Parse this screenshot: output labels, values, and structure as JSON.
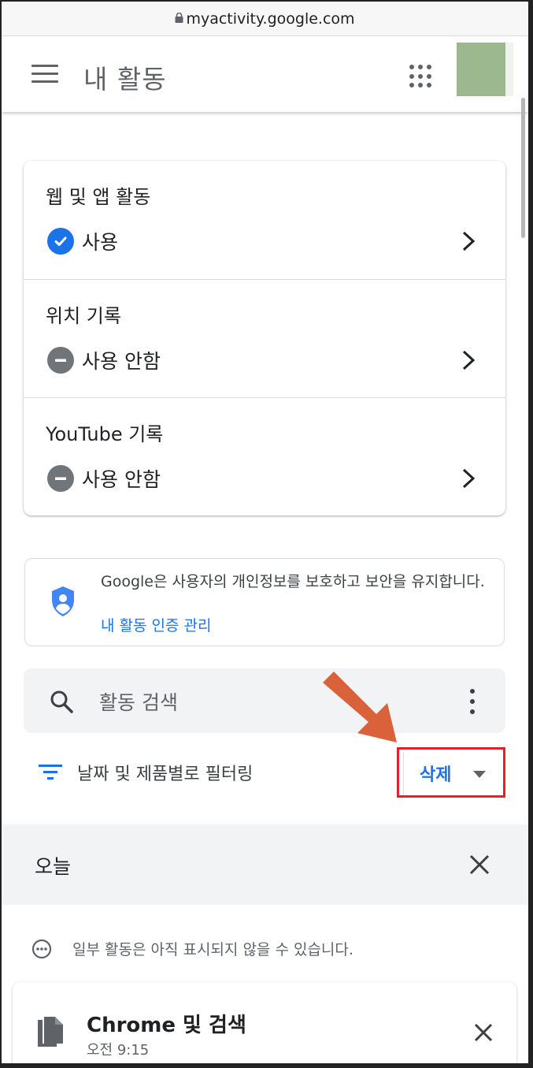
{
  "browser": {
    "url": "myactivity.google.com"
  },
  "header": {
    "title": "내 활동"
  },
  "settings": [
    {
      "name": "웹 및 앱 활동",
      "status": "사용",
      "state": "on"
    },
    {
      "name": "위치 기록",
      "status": "사용 안함",
      "state": "off"
    },
    {
      "name": "YouTube 기록",
      "status": "사용 안함",
      "state": "off"
    }
  ],
  "security": {
    "text": "Google은 사용자의 개인정보를 보호하고 보안을 유지합니다.",
    "link": "내 활동 인증 관리"
  },
  "search": {
    "placeholder": "활동 검색"
  },
  "filter": {
    "label": "날짜 및 제품별로 필터링"
  },
  "delete": {
    "label": "삭제"
  },
  "today": {
    "label": "오늘",
    "notice": "일부 활동은 아직 표시되지 않을 수 있습니다."
  },
  "activity": {
    "title": "Chrome 및 검색",
    "time": "오전 9:15"
  },
  "colors": {
    "accent": "#1a73e8",
    "highlight": "#e0232a",
    "arrow": "#d9623b",
    "status_off": "#70757a"
  }
}
